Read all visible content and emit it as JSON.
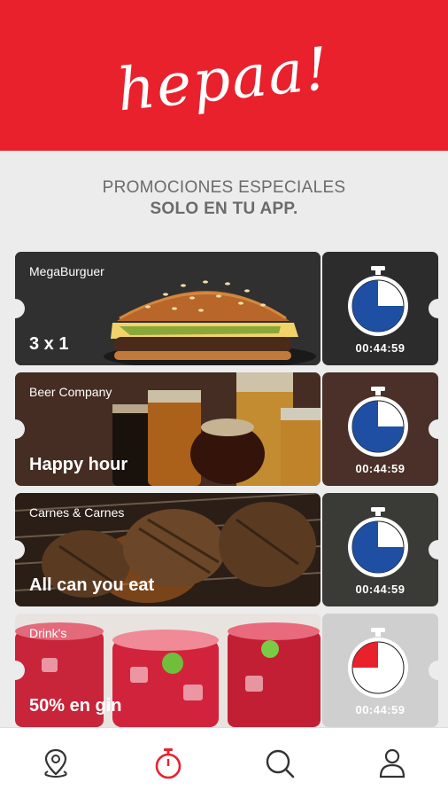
{
  "header": {
    "logo_text": "hepaa!",
    "color": "#e8212c"
  },
  "promo": {
    "line1": "PROMOCIONES ESPECIALES",
    "line2": "SOLO EN TU APP."
  },
  "promotions": [
    {
      "vendor": "MegaBurguer",
      "offer": "3 x 1",
      "timer": "00:44:59",
      "remaining_fraction": 0.75,
      "fill_color": "#1e4fa3",
      "image": "burger"
    },
    {
      "vendor": "Beer Company",
      "offer": "Happy hour",
      "timer": "00:44:59",
      "remaining_fraction": 0.75,
      "fill_color": "#1e4fa3",
      "image": "beer"
    },
    {
      "vendor": "Carnes & Carnes",
      "offer": "All can you eat",
      "timer": "00:44:59",
      "remaining_fraction": 0.75,
      "fill_color": "#1e4fa3",
      "image": "steaks"
    },
    {
      "vendor": "Drink's",
      "offer": "50% en gin",
      "timer": "00:44:59",
      "remaining_fraction": 0.25,
      "fill_color": "#e8212c",
      "image": "drinks"
    }
  ],
  "nav": [
    {
      "icon": "location-pin-icon",
      "active": false
    },
    {
      "icon": "stopwatch-icon",
      "active": true
    },
    {
      "icon": "search-icon",
      "active": false
    },
    {
      "icon": "user-icon",
      "active": false
    }
  ]
}
